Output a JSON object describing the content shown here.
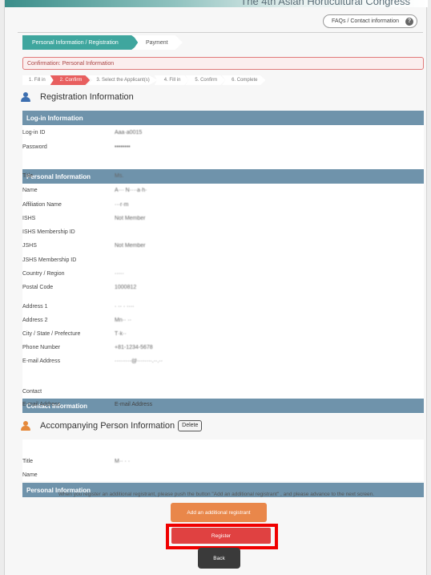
{
  "header": {
    "banner_title": "The 4th Asian Horticultural Congress",
    "faq_label": "FAQs / Contact information",
    "faq_icon": "?"
  },
  "progress": {
    "step1": "Personal Information / Registration",
    "step2": "Payment"
  },
  "confirmation_bar": "Confirmation: Personal Information",
  "substeps": [
    "1. Fill in",
    "2. Confirm",
    "3. Select the Applicant(s)",
    "4. Fill in",
    "5. Confirm",
    "6. Complete"
  ],
  "registration": {
    "title": "Registration Information",
    "login_head": "Log-in Information",
    "login_rows": [
      {
        "label": "Log-in ID",
        "value": "Aaa·a0015"
      },
      {
        "label": "Password",
        "value": "••••••••"
      }
    ],
    "personal_head": "Personal Information",
    "personal_rows": [
      {
        "label": "Title",
        "value": "Ms."
      },
      {
        "label": "Name",
        "value": "A··· N····a·h·"
      },
      {
        "label": "Affiliation Name",
        "value": "···r·m"
      },
      {
        "label": "ISHS",
        "value": "Not Member"
      },
      {
        "label": "ISHS Membership ID",
        "value": ""
      },
      {
        "label": "JSHS",
        "value": "Not Member"
      },
      {
        "label": "JSHS Membership ID",
        "value": ""
      },
      {
        "label": "Country / Region",
        "value": "·····"
      },
      {
        "label": "Postal Code",
        "value": "1000812"
      },
      {
        "label": "Address 1",
        "value": "· ·· · ····"
      },
      {
        "label": "Address 2",
        "value": "Mn·· ··"
      },
      {
        "label": "City / State / Prefecture",
        "value": "T·k··"
      },
      {
        "label": "Phone Number",
        "value": "+81-1234-5678"
      },
      {
        "label": "E-mail Address",
        "value": "·········@········.··.··"
      }
    ],
    "contact_head": "Contact Information",
    "contact_rows": [
      {
        "label": "Contact",
        "value": ""
      },
      {
        "label": "E-mail Address",
        "value": "E-mail Address"
      }
    ]
  },
  "accompanying": {
    "title": "Accompanying Person Information",
    "delete_label": "Delete",
    "personal_head": "Personal Information",
    "rows": [
      {
        "label": "Title",
        "value": "M·· · ·"
      },
      {
        "label": "Name",
        "value": ""
      }
    ]
  },
  "note": "When you register an additional registrant, please push the button \"Add an additional registrant\" , and please advance to the next screen.",
  "buttons": {
    "add": "Add an additional registrant",
    "register": "Register",
    "back": "Back"
  },
  "colors": {
    "accent_teal": "#3fa69e",
    "header_blue": "#6f93ab",
    "register_red": "#e04141",
    "add_orange": "#e9874a"
  }
}
